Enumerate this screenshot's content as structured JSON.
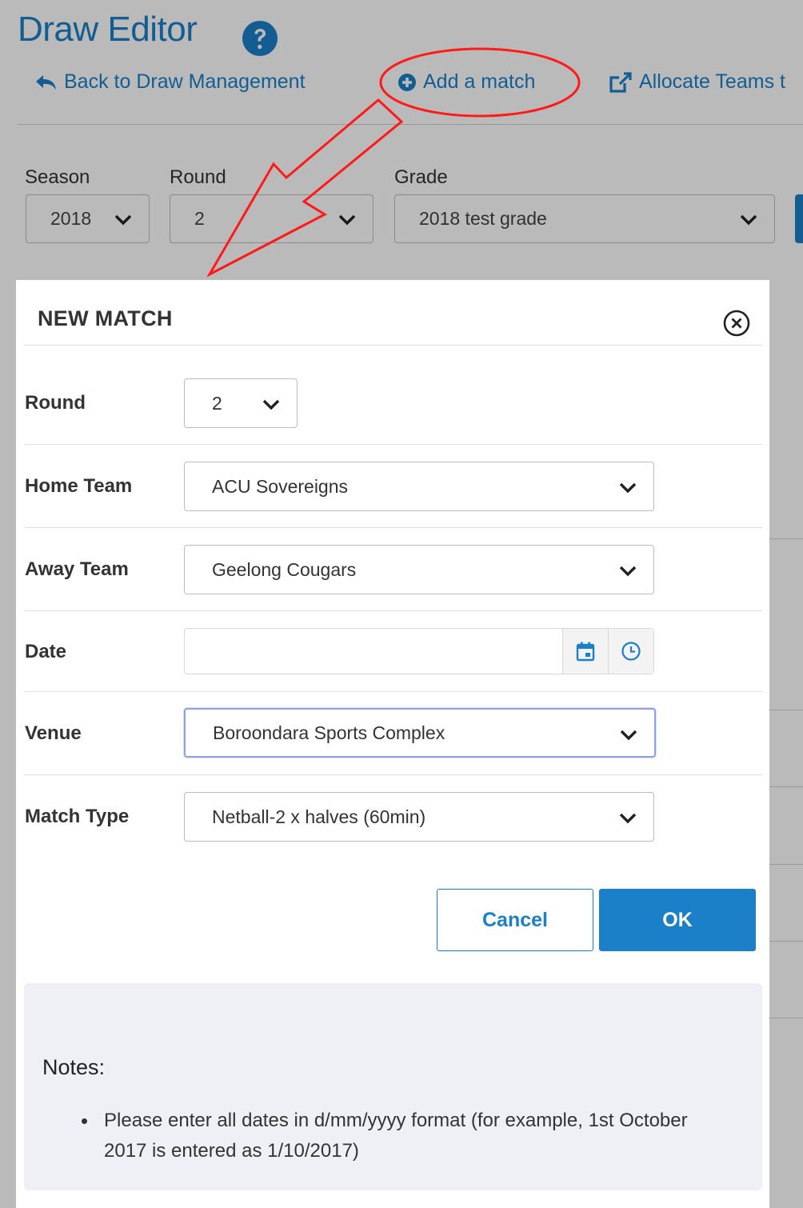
{
  "header": {
    "title": "Draw Editor",
    "help_icon": "question-circle-icon",
    "links": {
      "back": "Back to Draw Management",
      "add_match": "Add a match",
      "allocate": "Allocate Teams t"
    }
  },
  "filters": {
    "season": {
      "label": "Season",
      "value": "2018"
    },
    "round": {
      "label": "Round",
      "value": "2"
    },
    "grade": {
      "label": "Grade",
      "value": "2018 test grade"
    }
  },
  "modal": {
    "title": "NEW MATCH",
    "close_icon": "close-circle-icon",
    "fields": {
      "round": {
        "label": "Round",
        "value": "2"
      },
      "home_team": {
        "label": "Home Team",
        "value": "ACU Sovereigns"
      },
      "away_team": {
        "label": "Away Team",
        "value": "Geelong Cougars"
      },
      "date": {
        "label": "Date",
        "value": "",
        "calendar_icon": "calendar-icon",
        "clock_icon": "clock-icon"
      },
      "venue": {
        "label": "Venue",
        "value": "Boroondara Sports Complex"
      },
      "match_type": {
        "label": "Match Type",
        "value": "Netball-2 x halves (60min)"
      }
    },
    "buttons": {
      "cancel": "Cancel",
      "ok": "OK"
    },
    "notes": {
      "title": "Notes:",
      "items": [
        "Please enter all dates in d/mm/yyyy format (for example, 1st October 2017 is entered as 1/10/2017)"
      ]
    }
  },
  "colors": {
    "accent": "#1b80c8",
    "annotation": "#ff1a1a",
    "overlay": "rgba(0,0,0,0.27)",
    "notes_bg": "#eef0f5",
    "focus_border": "#8da2e8"
  }
}
